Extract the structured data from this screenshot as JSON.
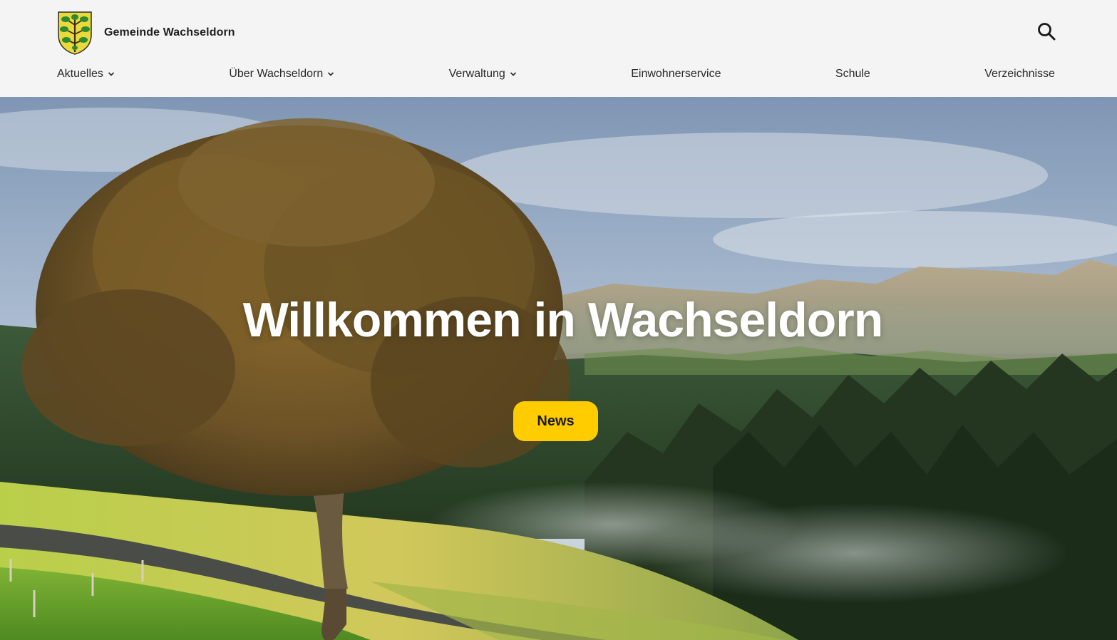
{
  "header": {
    "site_name": "Gemeinde Wachseldorn",
    "logo_icon": "coat-of-arms-icon",
    "search_icon": "search-icon"
  },
  "nav": {
    "items": [
      {
        "label": "Aktuelles",
        "has_dropdown": true
      },
      {
        "label": "Über Wachseldorn",
        "has_dropdown": true
      },
      {
        "label": "Verwaltung",
        "has_dropdown": true
      },
      {
        "label": "Einwohnerservice",
        "has_dropdown": false
      },
      {
        "label": "Schule",
        "has_dropdown": false
      },
      {
        "label": "Verzeichnisse",
        "has_dropdown": false
      }
    ]
  },
  "hero": {
    "title": "Willkommen in Wachseldorn",
    "button_label": "News"
  },
  "colors": {
    "accent": "#ffcc00",
    "header_bg": "#f4f4f4",
    "text": "#1f1f1f"
  }
}
